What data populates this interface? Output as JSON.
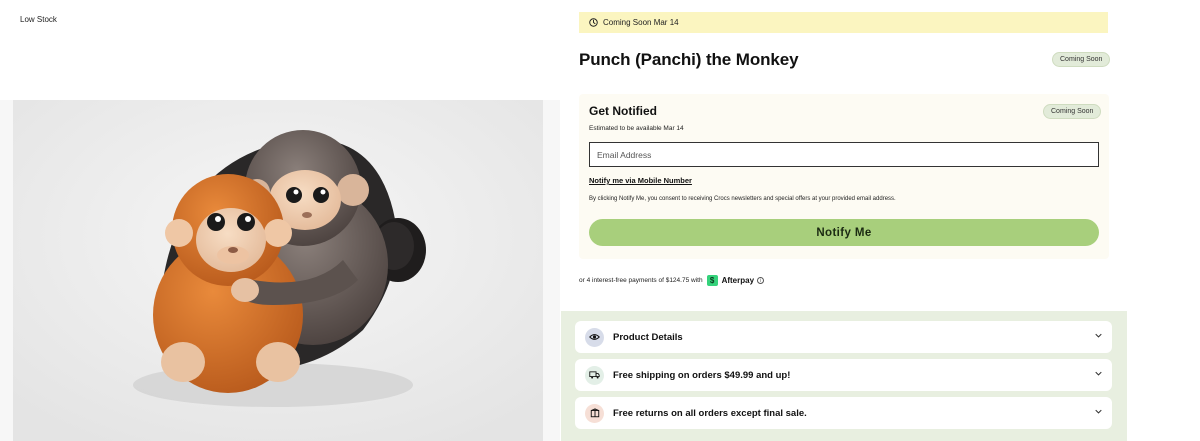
{
  "media": {
    "stock_badge": "Low Stock"
  },
  "banner": {
    "text": "Coming Soon Mar 14",
    "icon": "clock-icon"
  },
  "product": {
    "title": "Punch (Panchi) the Monkey",
    "status_pill": "Coming Soon"
  },
  "notify": {
    "title": "Get Notified",
    "status_pill": "Coming Soon",
    "estimate": "Estimated to be available Mar 14",
    "email_placeholder": "Email Address",
    "email_value": "",
    "mobile_link": "Notify me via Mobile Number",
    "consent": "By clicking Notify Me, you consent to receiving Crocs newsletters and special offers at your provided email address.",
    "button_label": "Notify Me"
  },
  "payment": {
    "installments_text": "or 4 interest-free payments of $124.75 with",
    "provider": "Afterpay",
    "provider_icon": "afterpay-logo-icon",
    "info_icon": "info-icon"
  },
  "accordions": [
    {
      "label": "Product Details",
      "icon": "eye-icon",
      "icon_bg": "#d7dce9"
    },
    {
      "label": "Free shipping on orders $49.99 and up!",
      "icon": "truck-icon",
      "icon_bg": "#e3efe7"
    },
    {
      "label": "Free returns on all orders except final sale.",
      "icon": "box-icon",
      "icon_bg": "#f6dfd6"
    }
  ],
  "colors": {
    "banner_bg": "#fbf5c0",
    "notify_button": "#a8cf7c",
    "accordion_panel": "#e8efe0",
    "afterpay_mint": "#35d27b"
  }
}
